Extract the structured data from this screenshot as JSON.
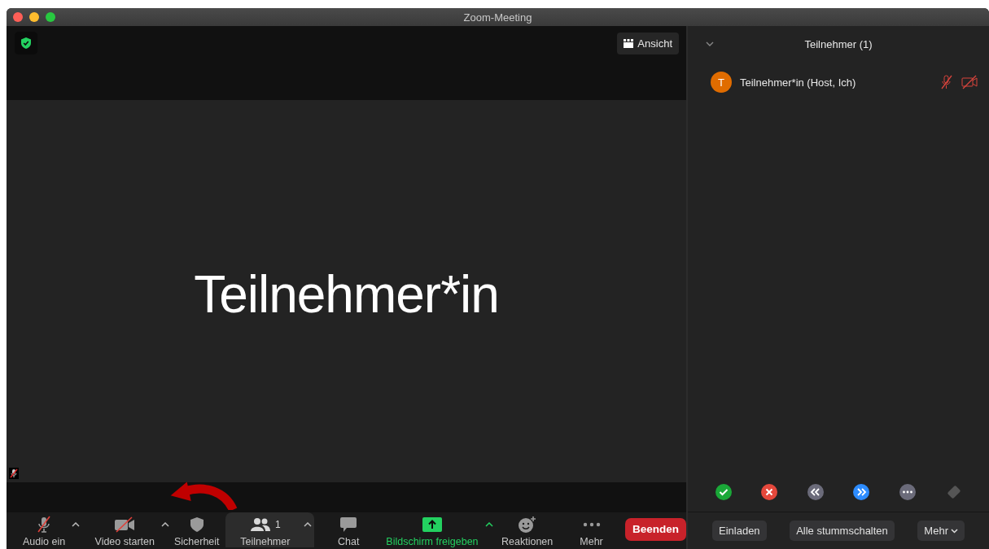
{
  "window": {
    "title": "Zoom-Meeting"
  },
  "video": {
    "view_button": "Ansicht",
    "display_name": "Teilnehmer*in",
    "self_muted": true
  },
  "toolbar": [
    {
      "kind": "audio",
      "label": "Audio ein",
      "muted": true,
      "has_menu": true,
      "selected": false
    },
    {
      "kind": "video",
      "label": "Video starten",
      "muted": true,
      "has_menu": true,
      "selected": false
    },
    {
      "kind": "security",
      "label": "Sicherheit",
      "has_menu": false,
      "selected": false
    },
    {
      "kind": "participants",
      "label": "Teilnehmer",
      "count": "1",
      "has_menu": true,
      "selected": true
    },
    {
      "kind": "chat",
      "label": "Chat",
      "has_menu": false,
      "selected": false
    },
    {
      "kind": "share",
      "label": "Bildschirm freigeben",
      "has_menu": true,
      "selected": false
    },
    {
      "kind": "reactions",
      "label": "Reaktionen",
      "has_menu": false,
      "selected": false
    },
    {
      "kind": "more",
      "label": "Mehr",
      "has_menu": false,
      "selected": false
    }
  ],
  "end_button": "Beenden",
  "panel": {
    "title": "Teilnehmer (1)",
    "participants": [
      {
        "initial": "T",
        "name": "Teilnehmer*in (Host, Ich)",
        "color": "#e06c00",
        "mic_muted": true,
        "video_off": true
      }
    ],
    "feedback": [
      {
        "kind": "yes"
      },
      {
        "kind": "no"
      },
      {
        "kind": "slower"
      },
      {
        "kind": "faster"
      },
      {
        "kind": "more"
      },
      {
        "kind": "clear"
      }
    ],
    "buttons": [
      {
        "label": "Einladen",
        "has_menu": false
      },
      {
        "label": "Alle stummschalten",
        "has_menu": false
      },
      {
        "label": "Mehr",
        "has_menu": true
      }
    ]
  }
}
